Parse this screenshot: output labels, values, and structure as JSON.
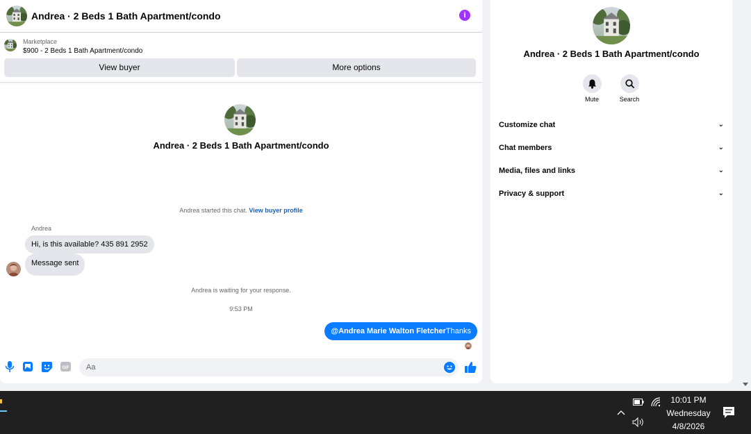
{
  "chat": {
    "title": "Andrea · 2 Beds 1 Bath Apartment/condo",
    "info_icon": "info-icon",
    "marketplace": {
      "label": "Marketplace",
      "listing": "$900 - 2 Beds 1 Bath Apartment/condo"
    },
    "buttons": {
      "view_buyer": "View buyer",
      "more_options": "More options"
    },
    "center_title": "Andrea · 2 Beds 1 Bath Apartment/condo",
    "started_text": "Andrea started this chat.",
    "view_profile_link": "View buyer profile",
    "sender_name": "Andrea",
    "messages_in": [
      "Hi, is this available? 435 891 2952",
      "Message sent"
    ],
    "waiting_text": "Andrea is waiting for your response.",
    "timestamp": "9:53 PM",
    "message_out": {
      "mention": "@Andrea Marie Walton Fletcher",
      "text": "Thanks"
    },
    "composer": {
      "placeholder": "Aa",
      "icons": [
        "microphone-icon",
        "image-icon",
        "sticker-icon",
        "gif-icon",
        "emoji-icon",
        "thumbs-up-icon"
      ]
    }
  },
  "info_panel": {
    "title": "Andrea · 2 Beds 1 Bath Apartment/condo",
    "actions": [
      {
        "label": "Mute",
        "icon": "bell-icon"
      },
      {
        "label": "Search",
        "icon": "search-icon"
      }
    ],
    "sections": [
      "Customize chat",
      "Chat members",
      "Media, files and links",
      "Privacy & support"
    ]
  },
  "taskbar": {
    "time": "10:01 PM",
    "day": "Wednesday",
    "date": "4/8/2026"
  },
  "colors": {
    "accent_blue": "#0a7cff",
    "info_purple": "#a033ff",
    "link_blue": "#1a5fb4",
    "bubble_gray": "#e4e6eb"
  }
}
